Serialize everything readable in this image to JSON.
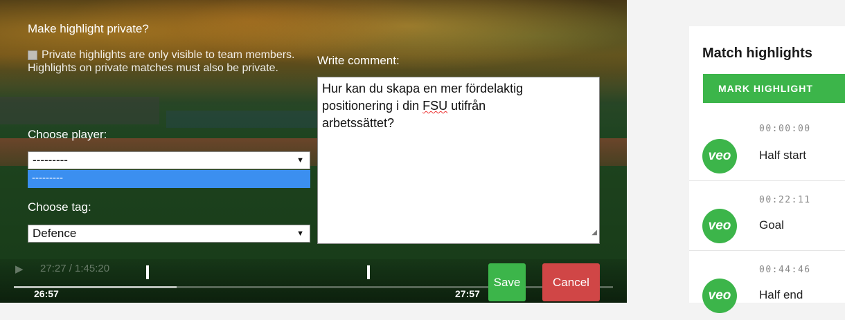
{
  "editor": {
    "private_label": "Make highlight private?",
    "private_note": "Private highlights are only visible to team members. Highlights on private matches must also be private.",
    "player_label": "Choose player:",
    "player_value": "---------",
    "player_option": "---------",
    "tag_label": "Choose tag:",
    "tag_value": "Defence",
    "comment_label": "Write comment:",
    "comment_value_1": "Hur kan du skapa en mer fördelaktig",
    "comment_value_2a": "positionering i din ",
    "comment_value_2b": "FSU",
    "comment_value_2c": " utifrån",
    "comment_value_3": "arbetssättet?",
    "save_label": "Save",
    "cancel_label": "Cancel"
  },
  "player_controls": {
    "current_total": "27:27 / 1:45:20",
    "clip_start": "26:57",
    "clip_end": "27:57"
  },
  "panel": {
    "title": "Match highlights",
    "mark_button": "MARK HIGHLIGHT",
    "highlights": [
      {
        "time": "00:00:00",
        "label": "Half start",
        "badge": "veo"
      },
      {
        "time": "00:22:11",
        "label": "Goal",
        "badge": "veo"
      },
      {
        "time": "00:44:46",
        "label": "Half end",
        "badge": "veo"
      }
    ]
  },
  "colors": {
    "accent_green": "#3cb54a",
    "cancel_red": "#d04646",
    "dropdown_blue": "#3b8ff0"
  }
}
